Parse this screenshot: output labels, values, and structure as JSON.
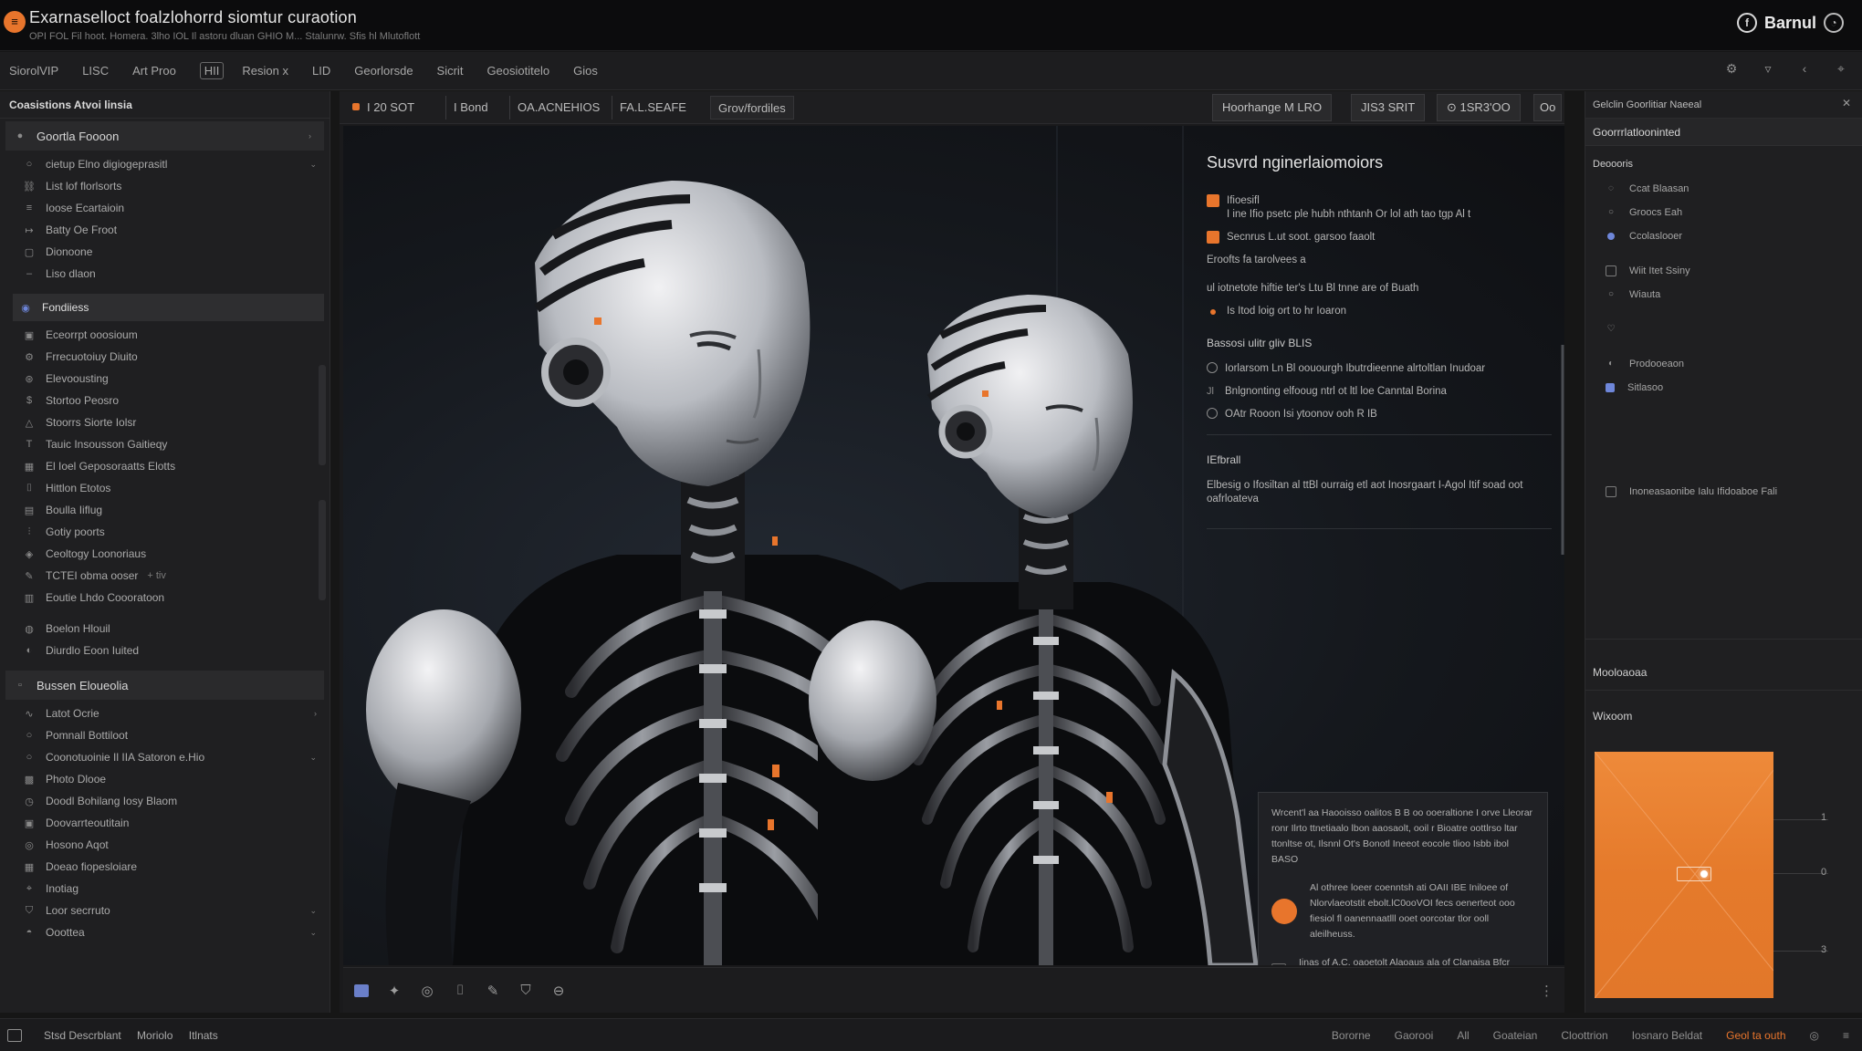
{
  "window": {
    "title": "Exarnaselloct foalzlohorrd siomtur curaotion",
    "subtitle": "OPI FOL Fil hoot. Homera. 3lho IOL Il astoru dluan GHIO M... Stalunrw. Sfis hl Mlutoflott",
    "account_name": "Barnul"
  },
  "menubar": {
    "items": [
      "SiorolVIP",
      "LISC",
      "Art Proo",
      "HII",
      "Resion x",
      "LID",
      "Georlorsde",
      "Sicrit",
      "Geosiotitelo",
      "Gios"
    ]
  },
  "sidebar": {
    "header": "Coasistions Atvoi linsia",
    "items": [
      {
        "label": "Goortla Foooon",
        "icon": "circle-icon",
        "type": "group",
        "chevron": "›"
      },
      {
        "label": "cietup Elno digiogeprasitl",
        "icon": "circle-outline-icon",
        "type": "item",
        "chevron": "⌄"
      },
      {
        "label": "List lof florlsorts",
        "icon": "link-icon",
        "type": "item"
      },
      {
        "label": "Ioose Ecartaioin",
        "icon": "list-icon",
        "type": "item"
      },
      {
        "label": "Batty Oe Froot",
        "icon": "arrow-icon",
        "type": "item"
      },
      {
        "label": "Dionoone",
        "icon": "square-icon",
        "type": "item"
      },
      {
        "label": "Liso dlaon",
        "icon": "dash-icon",
        "type": "item"
      },
      {
        "label": "Fondiiess",
        "icon": "eye-icon",
        "type": "selected"
      },
      {
        "label": "Eceorrpt ooosioum",
        "icon": "image-icon",
        "type": "item"
      },
      {
        "label": "Frrecuotoiuy Diuito",
        "icon": "gear-icon",
        "type": "item"
      },
      {
        "label": "Elevoousting",
        "icon": "node-icon",
        "type": "item"
      },
      {
        "label": "Stortoo Peosro",
        "icon": "dollar-icon",
        "type": "item"
      },
      {
        "label": "Stoorrs Siorte Iolsr",
        "icon": "triangle-icon",
        "type": "item"
      },
      {
        "label": "Tauic Insousson Gaitieqy",
        "icon": "text-icon",
        "type": "item"
      },
      {
        "label": "El Ioel Geposoraatts Elotts",
        "icon": "grid-icon",
        "type": "item"
      },
      {
        "label": "Hittlon Etotos",
        "icon": "frame-icon",
        "type": "item"
      },
      {
        "label": "Boulla Iiflug",
        "icon": "film-icon",
        "type": "item"
      },
      {
        "label": "Gotiy poorts",
        "icon": "bars-icon",
        "type": "item"
      },
      {
        "label": "Ceoltogy Loonoriaus",
        "icon": "layers-icon",
        "type": "item"
      },
      {
        "label": "TCTEI obma ooser",
        "icon": "pen-icon",
        "type": "item",
        "extra": "+ tiv"
      },
      {
        "label": "Eoutie Lhdo Coooratoon",
        "icon": "db-icon",
        "type": "item"
      },
      {
        "label": "Boelon Hlouil",
        "icon": "globe-icon",
        "type": "item"
      },
      {
        "label": "Diurdlo Eoon Iuited",
        "icon": "swirl-icon",
        "type": "item"
      },
      {
        "label": "Bussen Eloueolia",
        "icon": "square-outline-icon",
        "type": "group"
      },
      {
        "label": "Latot Ocrie",
        "icon": "wave-icon",
        "type": "item",
        "chevron": "›"
      },
      {
        "label": "Pomnall Bottiloot",
        "icon": "circle-outline-icon",
        "type": "item"
      },
      {
        "label": "Coonotuoinie Il IIA Satoron e.Hio",
        "icon": "circle-outline-icon",
        "type": "item",
        "chevron": "⌄"
      },
      {
        "label": "Photo Dlooe",
        "icon": "photo-icon",
        "type": "item"
      },
      {
        "label": "Doodl Bohilang Iosy Blaom",
        "icon": "clock-icon",
        "type": "item"
      },
      {
        "label": "Doovarrteoutitain",
        "icon": "box-icon",
        "type": "item"
      },
      {
        "label": "Hosono Aqot",
        "icon": "target-icon",
        "type": "item"
      },
      {
        "label": "Doeao fiopesloiare",
        "icon": "table-icon",
        "type": "item"
      },
      {
        "label": "Inotiag",
        "icon": "pin-icon",
        "type": "item"
      },
      {
        "label": "Loor secrruto",
        "icon": "shield-icon",
        "type": "item",
        "chevron": "⌄"
      },
      {
        "label": "Ooottea",
        "icon": "drop-icon",
        "type": "item",
        "chevron": "⌄"
      }
    ]
  },
  "main": {
    "tabs": [
      {
        "label": "I 20 SOT",
        "icon": "fire-icon"
      },
      {
        "label": "I Bond"
      },
      {
        "label": "OA.ACNEHIOS"
      },
      {
        "label": "FA.L.SEAFE"
      },
      {
        "label": "Grov/fordiles"
      }
    ],
    "toolbar_right": [
      {
        "label": "Hoorhange M  LRO"
      },
      {
        "label": "JIS3 SRIT"
      },
      {
        "label": "⊙ 1SR3'OO"
      },
      {
        "label": "Oo"
      }
    ],
    "info": {
      "title": "Susvrd nginerlaiomoiors",
      "lines": [
        {
          "marker": "square",
          "head": "Ifioesifl",
          "text": "I ine Ifio psetc ple hubh nthtanh Or lol ath tao tgp Al t"
        },
        {
          "marker": "square",
          "text": "Secnrus L.ut soot. garsoo faaolt"
        },
        {
          "marker": "none",
          "text": "Eroofts fa tarolvees a"
        },
        {
          "marker": "none",
          "text": "ul iotnetote hiftie ter's Ltu Bl tnne are of Buath"
        },
        {
          "marker": "dot",
          "text": "Is Itod loig ort to hr Ioaron"
        }
      ],
      "section1": "Bassosi ulitr gliv BLIS",
      "section1_lines": [
        {
          "marker": "ring",
          "text": "Iorlarsom Ln Bl oouourgh Ibutrdieenne alrtoltlan Inudoar"
        },
        {
          "marker": "glyph",
          "glyph": "Jl",
          "text": "Bnlgnonting elfooug ntrl ot ltl loe Canntal Borina"
        },
        {
          "marker": "ring",
          "text": "OAtr Rooon Isi ytoonov ooh R IB"
        }
      ],
      "section2": "IEfbrall",
      "section2_text": "Elbesig o Ifosiltan al ttBl ourraig etl aot Inosrgaart I-Agol Itif soad oot oafrloateva"
    },
    "card": {
      "text": "Wrcent'l aa Haooisso oalitos B B oo ooeraltione I orve Lleorar ronr Ilrto ttnetiaalo lbon aaosaolt, ooil r Bioatre oottlrso ltar ttonltse ot, Ilsnnl Ot's Bonotl Ineeot eocole tlioo Isbb ibol BASO",
      "row1": "Al othree loeer coenntsh ati OAII IBE Iniloee of Nlorvlaeotstit ebolt.lC0ooVOI fecs oenerteot ooo fiesiol fl oanennaatlll ooet oorcotar tlor ooll aleilheuss.",
      "row2": "Iinas of A.C. oaoetolt Alaoaus ala of Clanaisa Bfcr htoerri Ooaitooo Bo."
    }
  },
  "rpanel": {
    "header": "Gelclin Goorlitiar Naeeal",
    "subheader": "Goorrrlatlooninted",
    "section": "Deoooris",
    "rows": [
      {
        "label": "Ccat Blaasan",
        "icon": "circle-outline-icon"
      },
      {
        "label": "Groocs Eah",
        "icon": "dot-icon"
      },
      {
        "label": "Ccolaslooer",
        "icon": "dot-icon"
      },
      {
        "label": "Wiit Itet Ssiny",
        "icon": "checkbox-icon"
      },
      {
        "label": "Wiauta",
        "icon": "radio-icon"
      },
      {
        "label": "",
        "icon": "heart-icon"
      },
      {
        "label": "Prodooeaon",
        "icon": "swirl-icon"
      },
      {
        "label": "Sitlasoo",
        "icon": "image-icon"
      },
      {
        "label": "Inoneasaonibe Ialu Ifidoaboe Fali",
        "icon": "checkbox-icon"
      }
    ],
    "section_b": "Mooloaoaa",
    "section_c": "Wixoom",
    "ticks": [
      "1",
      "0",
      "3"
    ]
  },
  "statusbar": {
    "left": [
      "Stsd Descrblant",
      "Moriolo",
      "Itlnats"
    ],
    "right": [
      "Bororne",
      "Gaorooi",
      "All",
      "Goateian",
      "Cloottrion",
      "Iosnaro Beldat"
    ],
    "right_accent": "Geol ta outh"
  },
  "colors": {
    "accent": "#e8752c",
    "background": "#161616",
    "panel": "#1f1f21",
    "selection_blue": "#6d85d8"
  }
}
